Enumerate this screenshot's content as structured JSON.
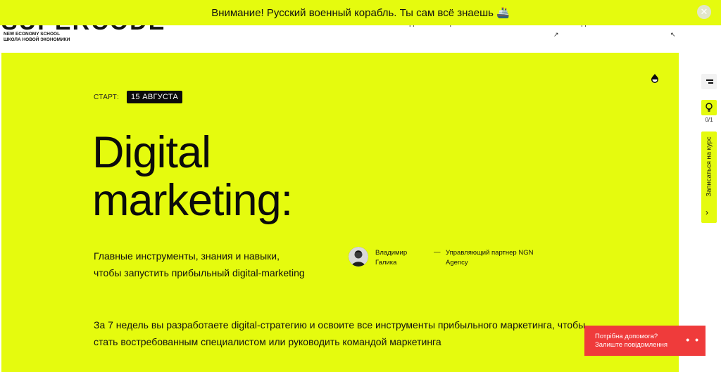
{
  "banner": {
    "text": "Внимание! Русский военный корабль. Ты сам всё знаешь 🚢",
    "close_glyph": "✕"
  },
  "nav": {
    "logo_word": "SUPERCODE",
    "logo_sub_1": "NEW ECONOMY SCHOOL",
    "logo_sub_2": "ШКОЛА НОВОЙ ЭКОНОМИКИ",
    "links": [
      "СИМУЛЯТОР",
      "МЕТОДЫ",
      "СООБЩЕСТВО",
      "ЭКСПЕРТЫ"
    ],
    "cabinet": "ВХОД В ЛИЧНЫЙ КАБИНЕТ",
    "arrow_left": "↗",
    "arrow_right": "↖"
  },
  "hero": {
    "start_label": "СТАРТ:",
    "start_date": "15 АВГУСТА",
    "title_line_1": "Digital",
    "title_line_2": "marketing:",
    "lead": "Главные инструменты, знания и навыки, чтобы запустить прибыльный digital-marketing",
    "mentor_name": "Владимир Галика",
    "mentor_dash": "—",
    "mentor_role": "Управляющий партнер NGN Agency",
    "description": "За 7 недель вы разработаете digital-стратегию и освоите все инструменты прибыльного маркетинга, чтобы стать востребованным специалистом или руководить командой маркетинга"
  },
  "rail": {
    "count": "0/1",
    "enroll": "Записаться на курс",
    "enroll_arrow": "›"
  },
  "help": {
    "line_1": "Потрібна допомога?",
    "line_2": "Залиште повідомлення",
    "icon_glyph": "• •"
  },
  "colors": {
    "accent": "#e5fb0e",
    "help_red": "#ef3b3b",
    "dark": "#0b0b0b"
  }
}
